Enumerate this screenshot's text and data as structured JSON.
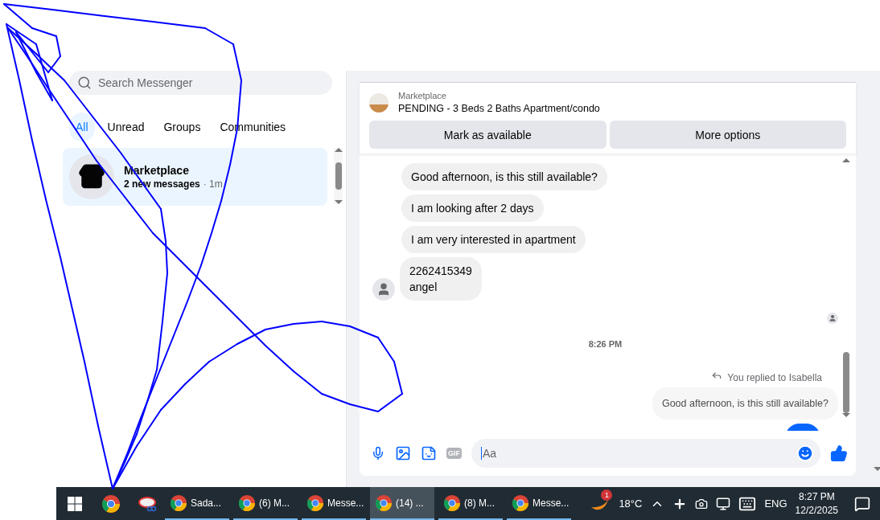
{
  "search": {
    "placeholder": "Search Messenger"
  },
  "filters": [
    {
      "label": "All",
      "selected": true
    },
    {
      "label": "Unread",
      "selected": false
    },
    {
      "label": "Groups",
      "selected": false
    },
    {
      "label": "Communities",
      "selected": false
    }
  ],
  "conversations": [
    {
      "name": "Marketplace",
      "preview": "2 new messages",
      "time": "· 1m",
      "selected": true
    }
  ],
  "listing": {
    "source": "Marketplace",
    "title": "PENDING - 3 Beds 2 Baths Apartment/condo"
  },
  "actions": [
    "Mark as available",
    "More options"
  ],
  "messages": [
    {
      "kind": "received",
      "lines": [
        "Good afternoon, is this still available?"
      ]
    },
    {
      "kind": "received",
      "lines": [
        "I am looking after 2 days"
      ]
    },
    {
      "kind": "received",
      "lines": [
        "I am very interested in apartment"
      ]
    },
    {
      "kind": "received_last",
      "lines": [
        "2262415349",
        "angel"
      ]
    },
    {
      "kind": "seen"
    },
    {
      "kind": "timestamp",
      "lines": [
        "8:26 PM"
      ]
    },
    {
      "kind": "reply_note",
      "lines": [
        "You replied to Isabella"
      ]
    },
    {
      "kind": "quote",
      "lines": [
        "Good afternoon, is this still available?"
      ]
    },
    {
      "kind": "sent_cut"
    }
  ],
  "composer": {
    "placeholder": "Aa",
    "gif": "GIF"
  },
  "taskbar": {
    "apps": [
      {
        "label": "Sada...",
        "selected": false
      },
      {
        "label": "(6) M...",
        "selected": false
      },
      {
        "label": "Messe...",
        "selected": false
      },
      {
        "label": "(14) ...",
        "selected": true
      },
      {
        "label": "(8) M...",
        "selected": false
      },
      {
        "label": "Messe...",
        "selected": false
      }
    ],
    "weather_badge": "1",
    "temperature": "18°C",
    "language": "ENG",
    "time": "8:27 PM",
    "date": "12/2/2025"
  }
}
